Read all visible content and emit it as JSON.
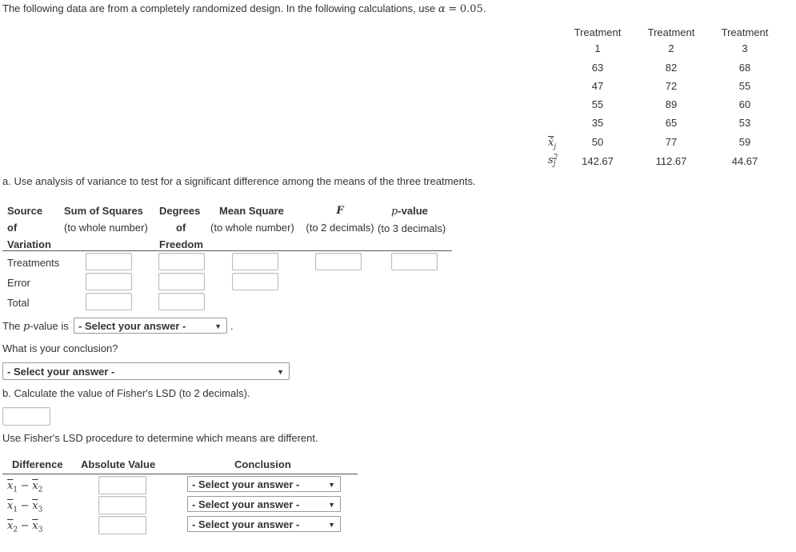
{
  "intro": {
    "text": "The following data are from a completely randomized design. In the following calculations, use",
    "alpha_symbol": "α",
    "equals": "=",
    "alpha_value": "0.05",
    "period": "."
  },
  "data_table": {
    "headers": [
      {
        "line1": "Treatment",
        "line2": "1"
      },
      {
        "line1": "Treatment",
        "line2": "2"
      },
      {
        "line1": "Treatment",
        "line2": "3"
      }
    ],
    "rows": [
      [
        "63",
        "82",
        "68"
      ],
      [
        "47",
        "72",
        "55"
      ],
      [
        "55",
        "89",
        "60"
      ],
      [
        "35",
        "65",
        "53"
      ]
    ],
    "mean_label": "x̄",
    "mean_sub": "j",
    "means": [
      "50",
      "77",
      "59"
    ],
    "var_label": "s",
    "var_sup": "2",
    "var_sub": "j",
    "variances": [
      "142.67",
      "112.67",
      "44.67"
    ]
  },
  "part_a": {
    "prompt": "a. Use analysis of variance to test for a significant difference among the means of the three treatments.",
    "anova_headers": {
      "source": [
        "Source",
        "of",
        "Variation"
      ],
      "ss": [
        "Sum of Squares",
        "(to whole number)"
      ],
      "df": [
        "Degrees",
        "of",
        "Freedom"
      ],
      "ms": [
        "Mean Square",
        "(to whole number)"
      ],
      "f": [
        "F",
        "(to 2 decimals)"
      ],
      "p": [
        "p",
        "-value",
        "(to 3 decimals)"
      ]
    },
    "anova_rows": [
      {
        "label": "Treatments",
        "ss": "",
        "df": "",
        "ms": "",
        "f": "",
        "p": ""
      },
      {
        "label": "Error",
        "ss": "",
        "df": "",
        "ms": ""
      },
      {
        "label": "Total",
        "ss": "",
        "df": ""
      }
    ],
    "pvalue_prefix": "The",
    "pvalue_p": "p",
    "pvalue_suffix": "-value is",
    "pvalue_select": "- Select your answer -",
    "pvalue_period": ".",
    "conclusion_question": "What is your conclusion?",
    "conclusion_select": "- Select your answer -"
  },
  "part_b": {
    "prompt": "b. Calculate the value of Fisher's LSD (to 2 decimals).",
    "lsd_value": "",
    "lsd_instruction": "Use Fisher's LSD procedure to determine which means are different.",
    "headers": {
      "difference": "Difference",
      "absolute": "Absolute Value",
      "conclusion": "Conclusion"
    },
    "rows": [
      {
        "a": "1",
        "b": "2",
        "value": "",
        "conclusion": "- Select your answer -"
      },
      {
        "a": "1",
        "b": "3",
        "value": "",
        "conclusion": "- Select your answer -"
      },
      {
        "a": "2",
        "b": "3",
        "value": "",
        "conclusion": "- Select your answer -"
      }
    ],
    "minus": "−",
    "x": "x"
  },
  "icons": {
    "dropdown_arrow": "▼"
  }
}
